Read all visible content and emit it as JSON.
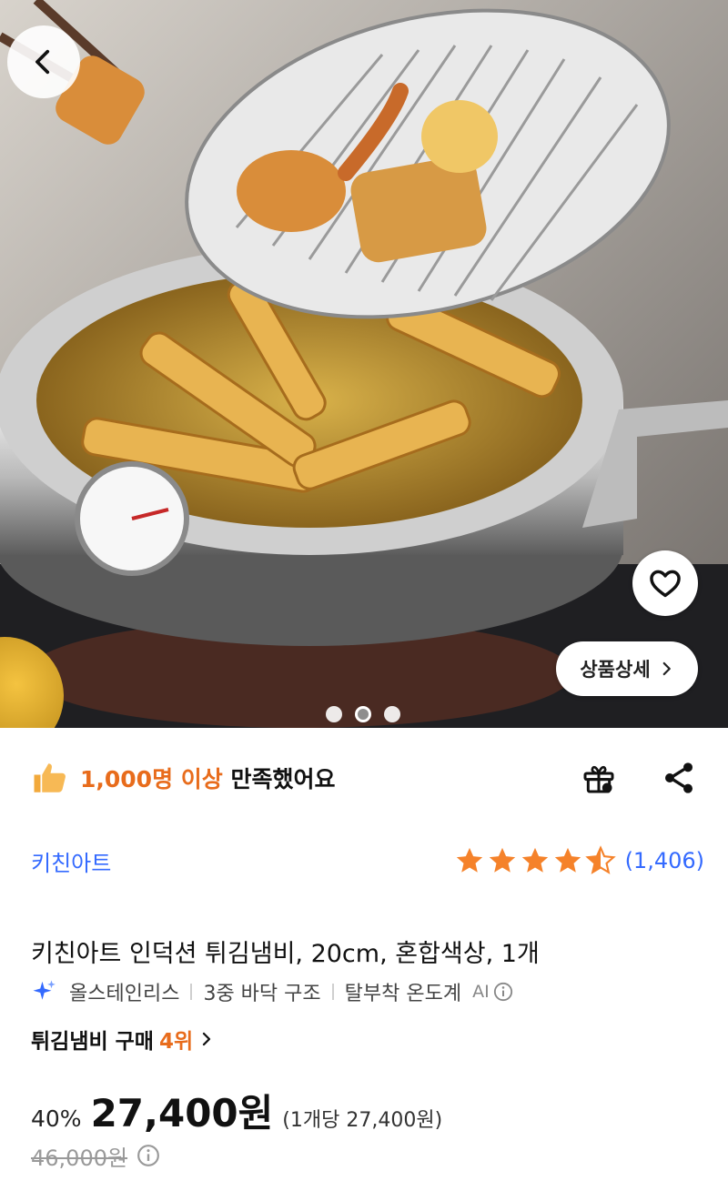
{
  "hero": {
    "back_icon": "chevron-left-icon",
    "wish_icon": "heart-icon",
    "detail_label": "상품상세",
    "detail_icon": "chevron-right-icon",
    "carousel": {
      "count": 3,
      "active_index": 1
    }
  },
  "satisfaction": {
    "icon": "thumbs-up-icon",
    "highlight": "1,000명 이상",
    "rest": " 만족했어요",
    "actions": [
      "gift-icon",
      "share-icon"
    ]
  },
  "product": {
    "brand": "키친아트",
    "rating": 4.5,
    "review_count": "(1,406)",
    "title": "키친아트 인덕션 튀김냄비, 20cm, 혼합색상, 1개",
    "tags_icon": "sparkle-icon",
    "tags": [
      "올스테인리스",
      "3중 바닥 구조",
      "탈부착 온도계"
    ],
    "ai_label": "AI",
    "rank_label": "튀김냄비 구매",
    "rank_value": "4위",
    "discount": "40%",
    "price": "27,400원",
    "unit_price": "(1개당 27,400원)",
    "original_price": "46,000원"
  },
  "colors": {
    "accent": "#346aff",
    "highlight": "#e86c1c",
    "star": "#f5822a"
  }
}
